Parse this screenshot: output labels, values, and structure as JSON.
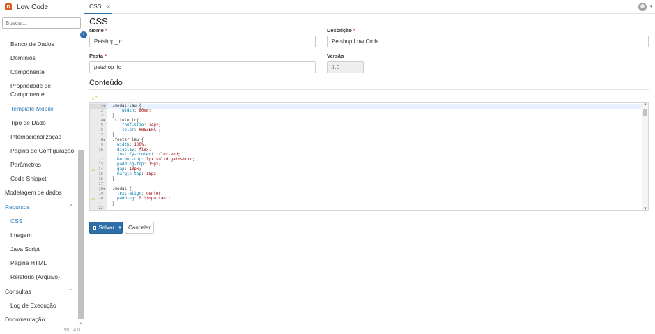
{
  "app": {
    "name": "Low Code",
    "logo_letter": "D",
    "version": "v0.14.0"
  },
  "sidebar": {
    "search_placeholder": "Buscar...",
    "items": [
      {
        "label": "Banco de Dados"
      },
      {
        "label": "Domínios"
      },
      {
        "label": "Componente"
      },
      {
        "label": "Propriedade de"
      },
      {
        "label": "Componente"
      },
      {
        "label": "Template Mobile"
      },
      {
        "label": "Tipo de Dado"
      },
      {
        "label": "Internacionalização"
      },
      {
        "label": "Página de Configuração"
      },
      {
        "label": "Parâmetros"
      },
      {
        "label": "Code Snippet"
      },
      {
        "label": "Modelagem de dados"
      },
      {
        "label": "Recursos"
      },
      {
        "label": "CSS"
      },
      {
        "label": "Imagem"
      },
      {
        "label": "Java Script"
      },
      {
        "label": "Página HTML"
      },
      {
        "label": "Relatório (Arquivo)"
      },
      {
        "label": "Consultas"
      },
      {
        "label": "Log de Execução"
      },
      {
        "label": "Documentação"
      }
    ]
  },
  "tabs": [
    {
      "label": "CSS",
      "close": "×"
    }
  ],
  "page": {
    "title": "CSS",
    "fields": {
      "nome": {
        "label": "Nome",
        "required": "*",
        "value": "Petshop_lc"
      },
      "descricao": {
        "label": "Descrição",
        "required": "*",
        "value": "Petshop Low Code"
      },
      "pasta": {
        "label": "Pasta",
        "required": "*",
        "value": "petshop_lc"
      },
      "versao": {
        "label": "Versão",
        "value": "1.0"
      }
    },
    "section_title": "Conteúdo"
  },
  "editor": {
    "line_numbers": [
      "1",
      "2",
      "3",
      "4",
      "5",
      "6",
      "7",
      "8",
      "9",
      "10",
      "11",
      "12",
      "13",
      "14",
      "15",
      "16",
      "17",
      "18",
      "19",
      "20",
      "21",
      "22"
    ],
    "lines": [
      ".modal-lau {",
      "    width: 80vw;",
      "}",
      ".titulo_lc{",
      "    font-size: 24px;",
      "    color: #853EFA;;",
      "}",
      ".footer_lau {",
      "  width: 100%;",
      "  display: flex;",
      "  justify-content: flex-end;",
      "  border-top: 1px solid gainsboro;",
      "  padding-top: 15px;",
      "  gap: 10px;",
      "  margin-top: 15px;",
      "}",
      "",
      ".modal {",
      "  text-align: center;",
      "  padding: 0 !important;",
      "}",
      ""
    ]
  },
  "actions": {
    "save_label": "Salvar",
    "cancel_label": "Cancelar"
  },
  "colors": {
    "primary": "#2d6fa8",
    "required": "#d9534f",
    "active_nav": "#2e7ab5",
    "logo": "#e05a24"
  }
}
